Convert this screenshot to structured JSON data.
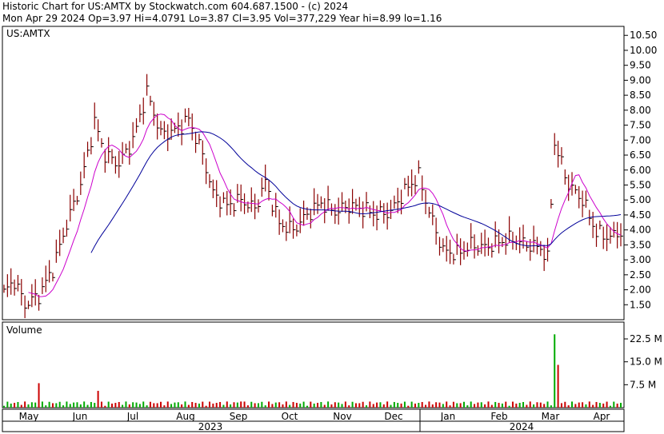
{
  "header": {
    "line1": "Historic Chart for US:AMTX by Stockwatch.com 604.687.1500 - (c) 2024",
    "line2": "Mon Apr 29 2024  Op=3.97  Hi=4.0791  Lo=3.87  Cl=3.95  Vol=377,229  Year hi=8.99  lo=1.16"
  },
  "chart_data": {
    "type": "ohlc",
    "symbol_label": "US:AMTX",
    "price_axis": {
      "ticks": [
        "1.50",
        "2.00",
        "2.50",
        "3.00",
        "3.50",
        "4.00",
        "4.50",
        "5.00",
        "5.50",
        "6.00",
        "6.50",
        "7.00",
        "7.50",
        "8.00",
        "8.50",
        "9.00",
        "9.50",
        "10.00",
        "10.50"
      ],
      "ylim": [
        1.0,
        10.8
      ],
      "position": "right"
    },
    "volume_panel": {
      "label": "Volume",
      "ticks": [
        "7.5 M",
        "15.0 M",
        "22.5 M"
      ],
      "ylim": [
        0,
        28
      ],
      "unit": "M"
    },
    "months": [
      "May",
      "Jun",
      "Jul",
      "Aug",
      "Sep",
      "Oct",
      "Nov",
      "Dec",
      "Jan",
      "Feb",
      "Mar",
      "Apr"
    ],
    "years": [
      "2023",
      "2024"
    ],
    "price_series": [
      {
        "name": "",
        "color": "#8b0000",
        "anchors_month_close": [
          [
            0,
            1.9
          ],
          [
            3,
            2.3
          ],
          [
            6,
            1.5
          ],
          [
            10,
            1.8
          ],
          [
            14,
            2.7
          ],
          [
            18,
            4.2
          ],
          [
            22,
            5.5
          ],
          [
            26,
            7.6
          ],
          [
            29,
            6.5
          ],
          [
            33,
            6.2
          ],
          [
            37,
            7.0
          ],
          [
            41,
            8.6
          ],
          [
            45,
            7.2
          ],
          [
            49,
            7.3
          ],
          [
            53,
            7.7
          ],
          [
            57,
            6.5
          ],
          [
            60,
            5.2
          ],
          [
            64,
            4.8
          ],
          [
            68,
            5.0
          ],
          [
            72,
            4.7
          ],
          [
            75,
            5.6
          ],
          [
            79,
            4.2
          ],
          [
            83,
            4.0
          ],
          [
            87,
            4.5
          ],
          [
            91,
            4.9
          ],
          [
            95,
            4.6
          ],
          [
            99,
            4.8
          ],
          [
            103,
            4.7
          ],
          [
            107,
            4.5
          ],
          [
            111,
            4.6
          ],
          [
            115,
            5.3
          ],
          [
            119,
            5.8
          ],
          [
            122,
            4.6
          ],
          [
            126,
            3.3
          ],
          [
            130,
            3.2
          ],
          [
            134,
            3.5
          ],
          [
            138,
            3.4
          ],
          [
            142,
            3.6
          ],
          [
            146,
            3.7
          ],
          [
            150,
            3.5
          ],
          [
            154,
            3.4
          ],
          [
            156,
            3.0
          ],
          [
            158,
            6.9
          ],
          [
            162,
            5.5
          ],
          [
            166,
            5.0
          ],
          [
            170,
            3.9
          ],
          [
            174,
            3.75
          ],
          [
            177,
            3.95
          ]
        ]
      },
      {
        "name": "",
        "color": "#cc00cc",
        "type": "moving-average-short"
      },
      {
        "name": "",
        "color": "#000099",
        "type": "moving-average-long"
      }
    ],
    "volume_spikes_M": [
      {
        "day": 10,
        "value": 8.0
      },
      {
        "day": 27,
        "value": 5.5
      },
      {
        "day": 68,
        "value": 2.0
      },
      {
        "day": 158,
        "value": 24.0
      },
      {
        "day": 159,
        "value": 14.0
      }
    ],
    "grid": false,
    "legend": "none"
  }
}
